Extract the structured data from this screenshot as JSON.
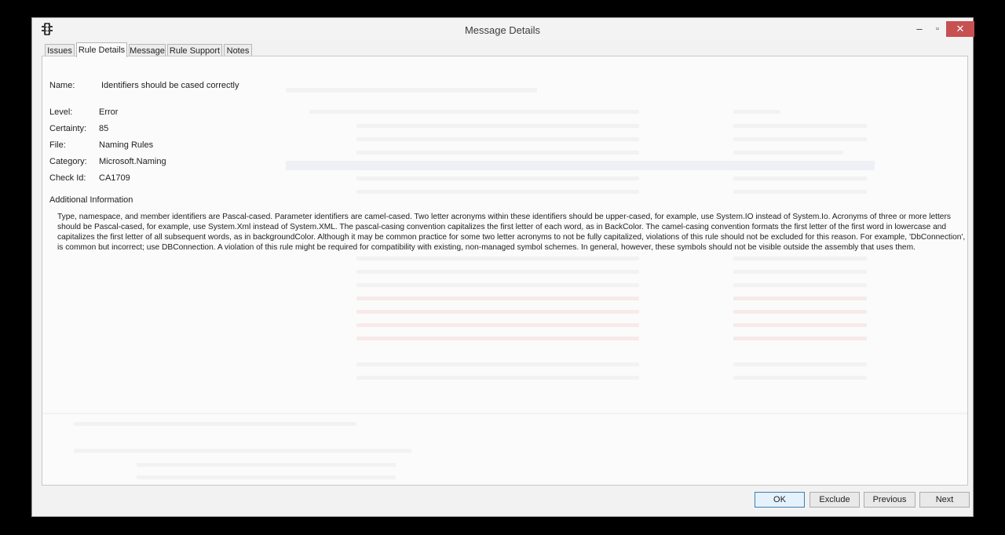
{
  "window": {
    "title": "Message Details",
    "controls": {
      "minimize": "–",
      "maximize": "▫",
      "close": "✕"
    }
  },
  "tabs": [
    {
      "label": "Issues"
    },
    {
      "label": "Rule Details",
      "active": true
    },
    {
      "label": "Message"
    },
    {
      "label": "Rule Support"
    },
    {
      "label": "Notes"
    }
  ],
  "details": {
    "name_label": "Name:",
    "name_value": "Identifiers should be cased correctly",
    "level_label": "Level:",
    "level_value": "Error",
    "certainty_label": "Certainty:",
    "certainty_value": "85",
    "file_label": "File:",
    "file_value": "Naming Rules",
    "category_label": "Category:",
    "category_value": "Microsoft.Naming",
    "checkid_label": "Check Id:",
    "checkid_value": "CA1709",
    "additional_label": "Additional Information",
    "additional_text": "Type, namespace, and member identifiers are Pascal-cased. Parameter identifiers are camel-cased. Two letter acronyms within these identifiers should be upper-cased, for example, use System.IO instead of System.Io. Acronyms of three or more letters should be Pascal-cased, for example, use System.Xml instead of System.XML. The pascal-casing convention capitalizes the first letter of each word, as in BackColor. The camel-casing convention formats the first letter of the first word in lowercase and capitalizes the first letter of all subsequent words, as in backgroundColor. Although it may be common practice for some two letter acronyms to not be fully capitalized, violations of this rule should not be excluded for this reason. For example, 'DbConnection', is common but incorrect; use DBConnection. A violation of this rule might be required for compatibility with existing, non-managed symbol schemes. In general, however, these symbols should not be visible outside the assembly that uses them."
  },
  "buttons": {
    "ok": "OK",
    "exclude": "Exclude",
    "previous": "Previous",
    "next": "Next"
  },
  "icons": {
    "app": "traffic-light-icon"
  }
}
